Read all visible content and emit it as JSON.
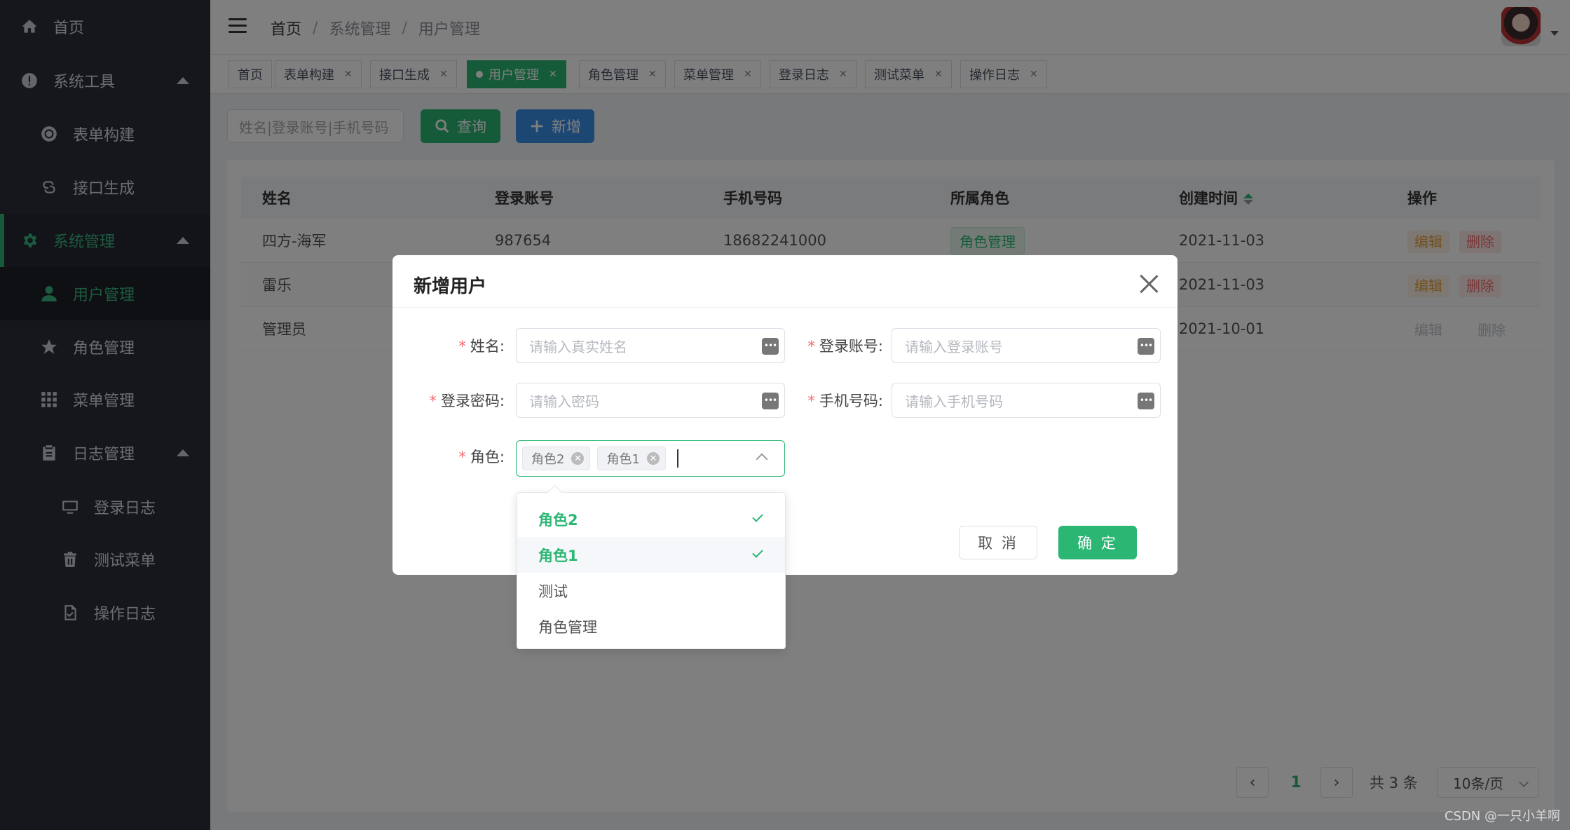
{
  "sidebar": {
    "items": [
      {
        "label": "首页",
        "icon": "home-icon"
      },
      {
        "label": "系统工具",
        "icon": "alert-circle-icon"
      },
      {
        "label": "表单构建",
        "icon": "lifebuoy-icon"
      },
      {
        "label": "接口生成",
        "icon": "link-icon"
      },
      {
        "label": "系统管理",
        "icon": "gear-icon"
      },
      {
        "label": "用户管理",
        "icon": "user-icon"
      },
      {
        "label": "角色管理",
        "icon": "star-icon"
      },
      {
        "label": "菜单管理",
        "icon": "grid-icon"
      },
      {
        "label": "日志管理",
        "icon": "clipboard-icon"
      },
      {
        "label": "登录日志",
        "icon": "monitor-icon"
      },
      {
        "label": "测试菜单",
        "icon": "trash-icon"
      },
      {
        "label": "操作日志",
        "icon": "document-icon"
      }
    ]
  },
  "header": {
    "breadcrumb": [
      "首页",
      "系统管理",
      "用户管理"
    ]
  },
  "tags": [
    "首页",
    "表单构建",
    "接口生成",
    "用户管理",
    "角色管理",
    "菜单管理",
    "登录日志",
    "测试菜单",
    "操作日志"
  ],
  "toolbar": {
    "search_placeholder": "姓名|登录账号|手机号码",
    "query_label": "查询",
    "add_label": "新增"
  },
  "table": {
    "headers": [
      "姓名",
      "登录账号",
      "手机号码",
      "所属角色",
      "创建时间",
      "操作"
    ],
    "rows": [
      {
        "name": "四方-海军",
        "account": "987654",
        "phone": "18682241000",
        "role": "角色管理",
        "created": "2021-11-03"
      },
      {
        "name": "雷乐",
        "account": "",
        "phone": "",
        "role": "",
        "created": "2021-11-03"
      },
      {
        "name": "管理员",
        "account": "",
        "phone": "",
        "role": "",
        "created": "2021-10-01"
      }
    ],
    "edit_label": "编辑",
    "delete_label": "删除"
  },
  "pagination": {
    "current": "1",
    "total_text": "共 3 条",
    "page_size": "10条/页"
  },
  "dialog": {
    "title": "新增用户",
    "fields": {
      "name_label": "姓名:",
      "name_placeholder": "请输入真实姓名",
      "account_label": "登录账号:",
      "account_placeholder": "请输入登录账号",
      "password_label": "登录密码:",
      "password_placeholder": "请输入密码",
      "phone_label": "手机号码:",
      "phone_placeholder": "请输入手机号码",
      "role_label": "角色:",
      "role_chips": [
        "角色2",
        "角色1"
      ]
    },
    "cancel_label": "取 消",
    "ok_label": "确 定"
  },
  "dropdown": {
    "options": [
      "角色2",
      "角色1",
      "测试",
      "角色管理"
    ]
  },
  "watermark": "CSDN @一只小羊啊",
  "colors": {
    "accent": "#2bb673",
    "sidebar_bg": "#2b2f3a",
    "add_button": "#3a8ee6"
  }
}
